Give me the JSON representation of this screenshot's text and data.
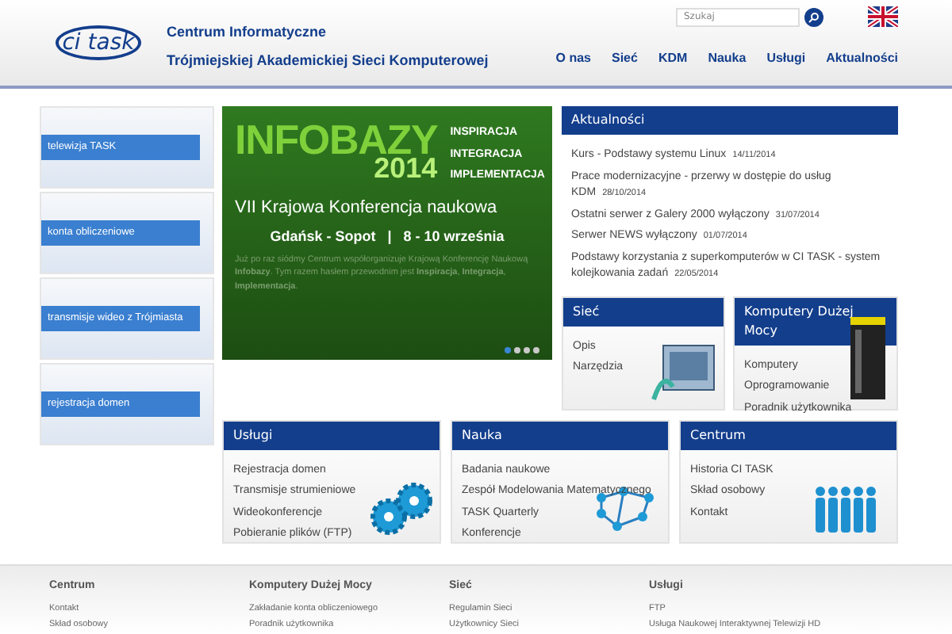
{
  "header": {
    "logo": "ci task",
    "title_line_1": "Centrum Informatyczne",
    "title_line_2": "Trójmiejskiej Akademickiej Sieci Komputerowej",
    "search": {
      "placeholder": "Szukaj"
    },
    "nav": [
      "O nas",
      "Sieć",
      "KDM",
      "Nauka",
      "Usługi",
      "Aktualności"
    ]
  },
  "tiles": [
    {
      "label": "telewizja TASK"
    },
    {
      "label": "konta obliczeniowe"
    },
    {
      "label": "transmisje wideo z Trójmiasta"
    },
    {
      "label": "rejestracja domen"
    }
  ],
  "slider": {
    "logo_word": "INFOBAZY",
    "logo_year": "2014",
    "mottos": [
      "INSPIRACJA",
      "INTEGRACJA",
      "IMPLEMENTACJA"
    ],
    "headline": "VII Krajowa Konferencja naukowa",
    "place": "Gdańsk - Sopot   |   8 - 10 września",
    "caption": "Już po raz siódmy Centrum współorganizuje Krajową Konferencję Naukową **Infobazy**. Tym razem hasłem przewodnim jest **Inspiracja**, **Integracja**, **Implementacja**.",
    "dots": [
      {
        "selected": true
      },
      {
        "selected": false
      },
      {
        "selected": false
      },
      {
        "selected": false
      }
    ]
  },
  "news": {
    "title": "Aktualności",
    "items": [
      {
        "text": "Kurs - Podstawy systemu Linux",
        "date": "14/11/2014"
      },
      {
        "text": "Prace modernizacyjne - przerwy w dostępie do usług KDM",
        "date": "28/10/2014"
      },
      {
        "text": "Ostatni serwer z Galery 2000 wyłączony",
        "date": "31/07/2014"
      },
      {
        "text": "Serwer NEWS wyłączony",
        "date": "01/07/2014"
      },
      {
        "text": "Podstawy korzystania z superkomputerów w CI TASK - system kolejkowania zadań",
        "date": "22/05/2014"
      }
    ]
  },
  "boxes": [
    {
      "title": "Sieć",
      "kind": "network",
      "links": [
        "Opis",
        "Narzędzia"
      ]
    },
    {
      "title": "Komputery Dużej Mocy",
      "kind": "server",
      "links": [
        "Komputery",
        "Oprogramowanie",
        "Poradnik użytkownika"
      ]
    },
    {
      "title": "Usługi",
      "kind": "gears",
      "links": [
        "Rejestracja domen",
        "Transmisje strumieniowe",
        "Wideokonferencje",
        "Pobieranie plików (FTP)"
      ]
    },
    {
      "title": "Nauka",
      "kind": "molecule",
      "links": [
        "Badania naukowe",
        "Zespół Modelowania Matematycznego",
        "TASK Quarterly",
        "Konferencje"
      ]
    },
    {
      "title": "Centrum",
      "kind": "people",
      "links": [
        "Historia CI TASK",
        "Skład osobowy",
        "Kontakt"
      ]
    }
  ],
  "footer": [
    {
      "title": "Centrum",
      "links": [
        "Kontakt",
        "Skład osobowy"
      ]
    },
    {
      "title": "Komputery Dużej Mocy",
      "links": [
        "Zakładanie konta obliczeniowego",
        "Poradnik użytkownika"
      ]
    },
    {
      "title": "Sieć",
      "links": [
        "Regulamin Sieci",
        "Użytkownicy Sieci"
      ]
    },
    {
      "title": "Usługi",
      "links": [
        "FTP",
        "Usługa Naukowej Interaktywnej Telewizji HD"
      ]
    }
  ]
}
